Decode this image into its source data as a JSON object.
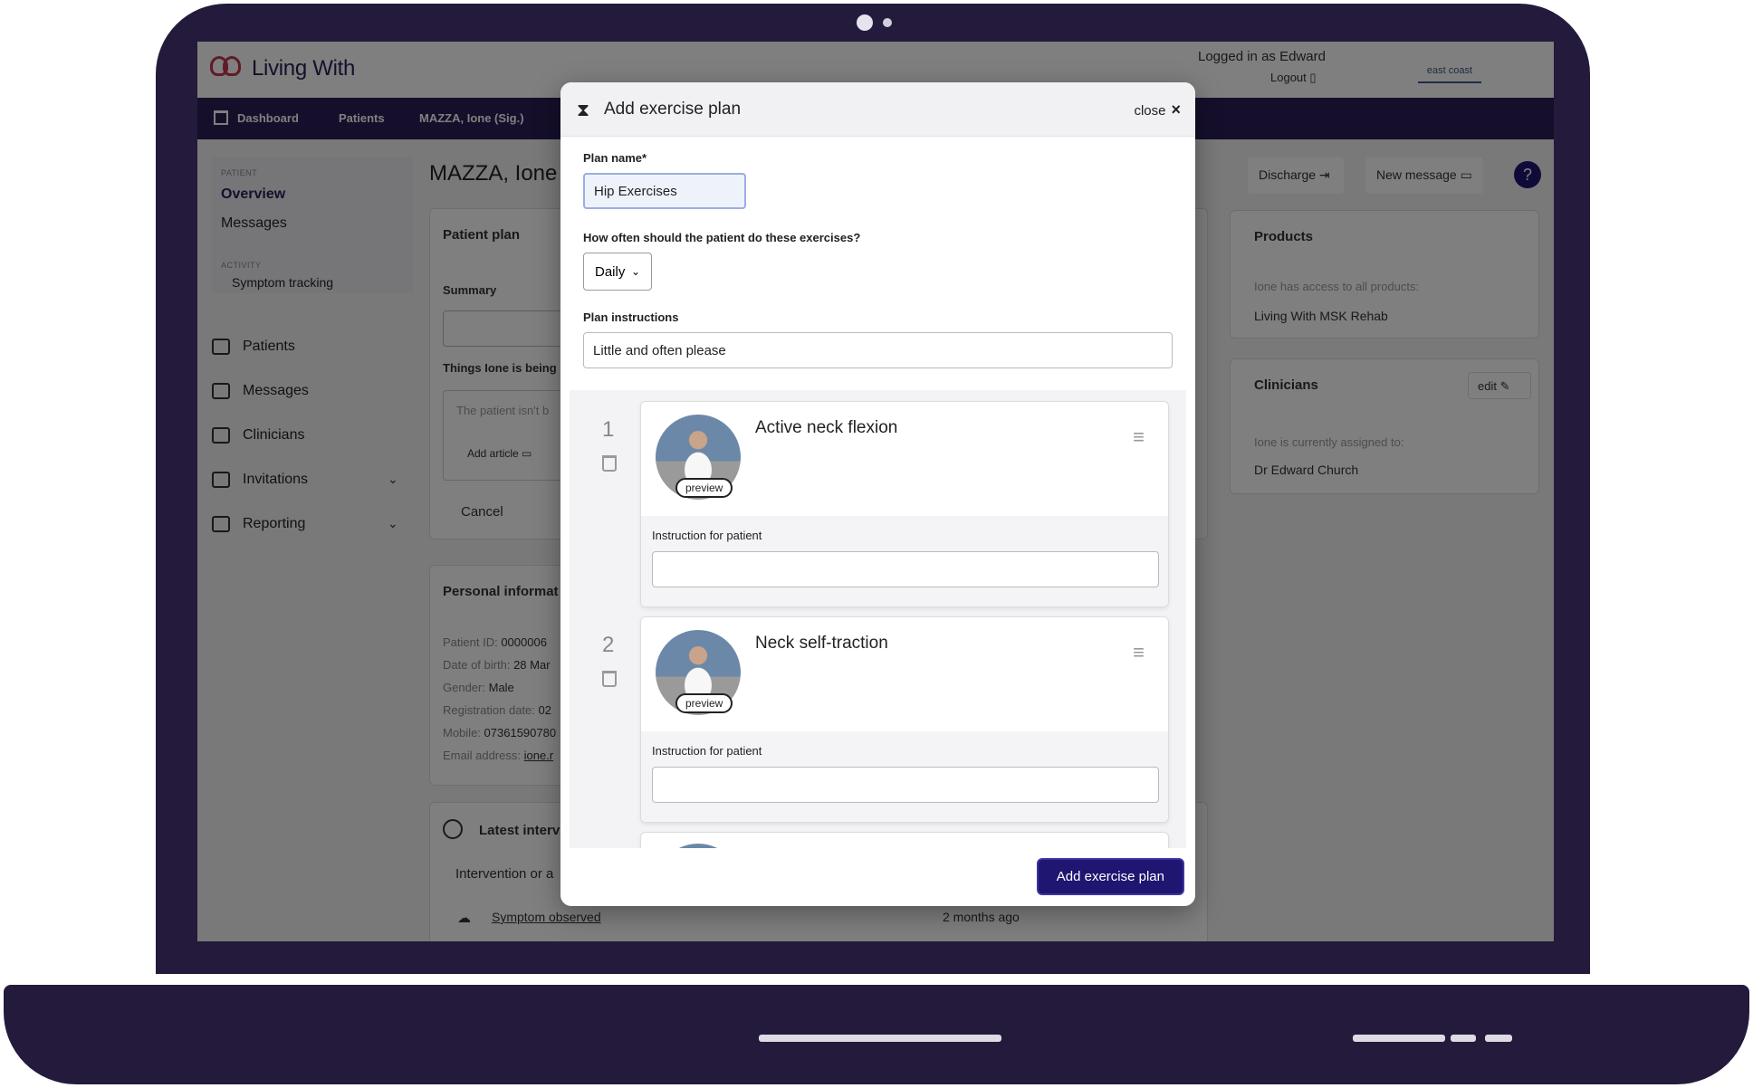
{
  "header": {
    "app_name": "Living With",
    "logged_in": "Logged in as Edward",
    "logout": "Logout",
    "org_logo_text": "east coast"
  },
  "nav": {
    "items": [
      "Dashboard",
      "Patients",
      "MAZZA, Ione (Sig.)"
    ]
  },
  "sidebar": {
    "patient_label": "PATIENT",
    "overview": "Overview",
    "messages": "Messages",
    "activity_label": "ACTIVITY",
    "symptom_tracking": "Symptom tracking",
    "menu": [
      "Patients",
      "Messages",
      "Clinicians",
      "Invitations",
      "Reporting"
    ]
  },
  "patient": {
    "name": "MAZZA, Ione (",
    "plan_title": "Patient plan",
    "summary": "Summary",
    "things_label": "Things Ione is being",
    "empty_text": "The patient isn't b",
    "add_article": "Add article",
    "cancel": "Cancel",
    "personal_title": "Personal informat",
    "personal_lines": [
      {
        "k": "Patient ID:",
        "v": "0000006"
      },
      {
        "k": "Date of birth:",
        "v": "28 Mar"
      },
      {
        "k": "Gender:",
        "v": "Male"
      },
      {
        "k": "Registration date:",
        "v": "02"
      },
      {
        "k": "Mobile:",
        "v": "07361590780"
      },
      {
        "k": "Email address:",
        "v": "ione.r"
      }
    ],
    "latest_title": "Latest interv",
    "intervention_col": "Intervention or a",
    "symptom_observed": "Symptom observed",
    "time_ago": "2 months ago"
  },
  "right_panel": {
    "discharge": "Discharge",
    "new_message": "New message",
    "help": "?",
    "products_title": "Products",
    "products_text": "Ione has access to all products:",
    "product_item": "Living With MSK Rehab",
    "clinicians_title": "Clinicians",
    "edit": "edit",
    "clinicians_text": "Ione is currently assigned to:",
    "clinician_item": "Dr Edward Church"
  },
  "modal": {
    "title": "Add exercise plan",
    "close": "close",
    "plan_name_label": "Plan name*",
    "plan_name_value": "Hip Exercises",
    "frequency_label": "How often should the patient do these exercises?",
    "frequency_value": "Daily",
    "instructions_label": "Plan instructions",
    "instructions_value": "Little and often please",
    "exercises": [
      {
        "num": "1",
        "name": "Active neck flexion",
        "preview": "preview",
        "instruction_label": "Instruction for patient",
        "instruction_value": ""
      },
      {
        "num": "2",
        "name": "Neck self-traction",
        "preview": "preview",
        "instruction_label": "Instruction for patient",
        "instruction_value": ""
      }
    ],
    "submit": "Add exercise plan"
  }
}
